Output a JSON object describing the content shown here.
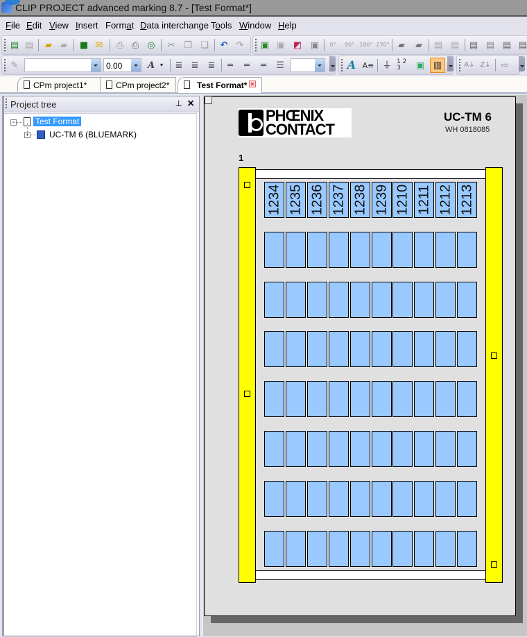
{
  "window": {
    "title": "CLIP PROJECT advanced marking 8.7 - [Test Format*]"
  },
  "menu": [
    {
      "label": "File",
      "accel": "F"
    },
    {
      "label": "Edit",
      "accel": "E"
    },
    {
      "label": "View",
      "accel": "V"
    },
    {
      "label": "Insert",
      "accel": "I"
    },
    {
      "label": "Format",
      "accel": "a"
    },
    {
      "label": "Data interchange",
      "accel": "D"
    },
    {
      "label": "Tools",
      "accel": "o"
    },
    {
      "label": "Window",
      "accel": "W"
    },
    {
      "label": "Help",
      "accel": "H"
    }
  ],
  "toolbar1": {
    "buttons": [
      "new-project-icon",
      "save-project-icon",
      "open-icon",
      "open-recent-icon",
      "save-icon",
      "export-icon",
      "print-icon",
      "print-preview-icon",
      "plot-icon",
      "cut-icon",
      "copy-icon",
      "paste-icon",
      "undo-icon",
      "redo-icon",
      "add-marker-icon",
      "duplicate-icon",
      "transfer-icon",
      "delete-marker-icon",
      "rotate-0-icon",
      "rotate-90-icon",
      "rotate-180-icon",
      "rotate-270-icon",
      "import-icon",
      "remove-icon",
      "wire-icon",
      "link-icon",
      "insert-icon",
      "settings-icon",
      "label-icon",
      "table-icon"
    ],
    "rotate_labels": [
      "0°",
      "90°",
      "180°",
      "270°"
    ]
  },
  "toolbar2": {
    "font_name": "",
    "font_size": "0.00",
    "style_value": "",
    "buttons": [
      "eraser-icon",
      "font-color-icon",
      "align-left-icon",
      "align-center-icon",
      "align-right-icon",
      "valign-top-icon",
      "valign-middle-icon",
      "valign-bottom-icon",
      "justify-icon",
      "text-style-icon",
      "text-format-icon",
      "strikethrough-icon",
      "numbering-icon",
      "image-icon",
      "marker-view-icon",
      "sort-ascending-icon",
      "sort-descending-icon",
      "export-arrow-icon"
    ],
    "numbering_label": "1 2 3"
  },
  "tabs": [
    {
      "label": "CPm project1*",
      "active": false
    },
    {
      "label": "CPm project2*",
      "active": false
    },
    {
      "label": "Test Format*",
      "active": true
    }
  ],
  "project_tree": {
    "title": "Project tree",
    "items": [
      {
        "label": "Test Format",
        "selected": true,
        "expander": "−"
      },
      {
        "label": "UC-TM 6 (BLUEMARK)",
        "selected": false,
        "expander": "+"
      }
    ]
  },
  "sheet": {
    "brand_line1": "PHŒNIX",
    "brand_line2": "CONTACT",
    "product_name": "UC-TM 6",
    "product_code": "WH 0818085",
    "card_number": "1",
    "colors": {
      "marker": "#99c9ff",
      "carrier": "#ffff00",
      "page": "#e0e0e0"
    },
    "rows": 8,
    "cols": 10,
    "markers": [
      [
        "1234",
        "1235",
        "1236",
        "1237",
        "1238",
        "1239",
        "1210",
        "1211",
        "1212",
        "1213"
      ],
      [
        "",
        "",
        "",
        "",
        "",
        "",
        "",
        "",
        "",
        ""
      ],
      [
        "",
        "",
        "",
        "",
        "",
        "",
        "",
        "",
        "",
        ""
      ],
      [
        "",
        "",
        "",
        "",
        "",
        "",
        "",
        "",
        "",
        ""
      ],
      [
        "",
        "",
        "",
        "",
        "",
        "",
        "",
        "",
        "",
        ""
      ],
      [
        "",
        "",
        "",
        "",
        "",
        "",
        "",
        "",
        "",
        ""
      ],
      [
        "",
        "",
        "",
        "",
        "",
        "",
        "",
        "",
        "",
        ""
      ],
      [
        "",
        "",
        "",
        "",
        "",
        "",
        "",
        "",
        "",
        ""
      ]
    ]
  }
}
